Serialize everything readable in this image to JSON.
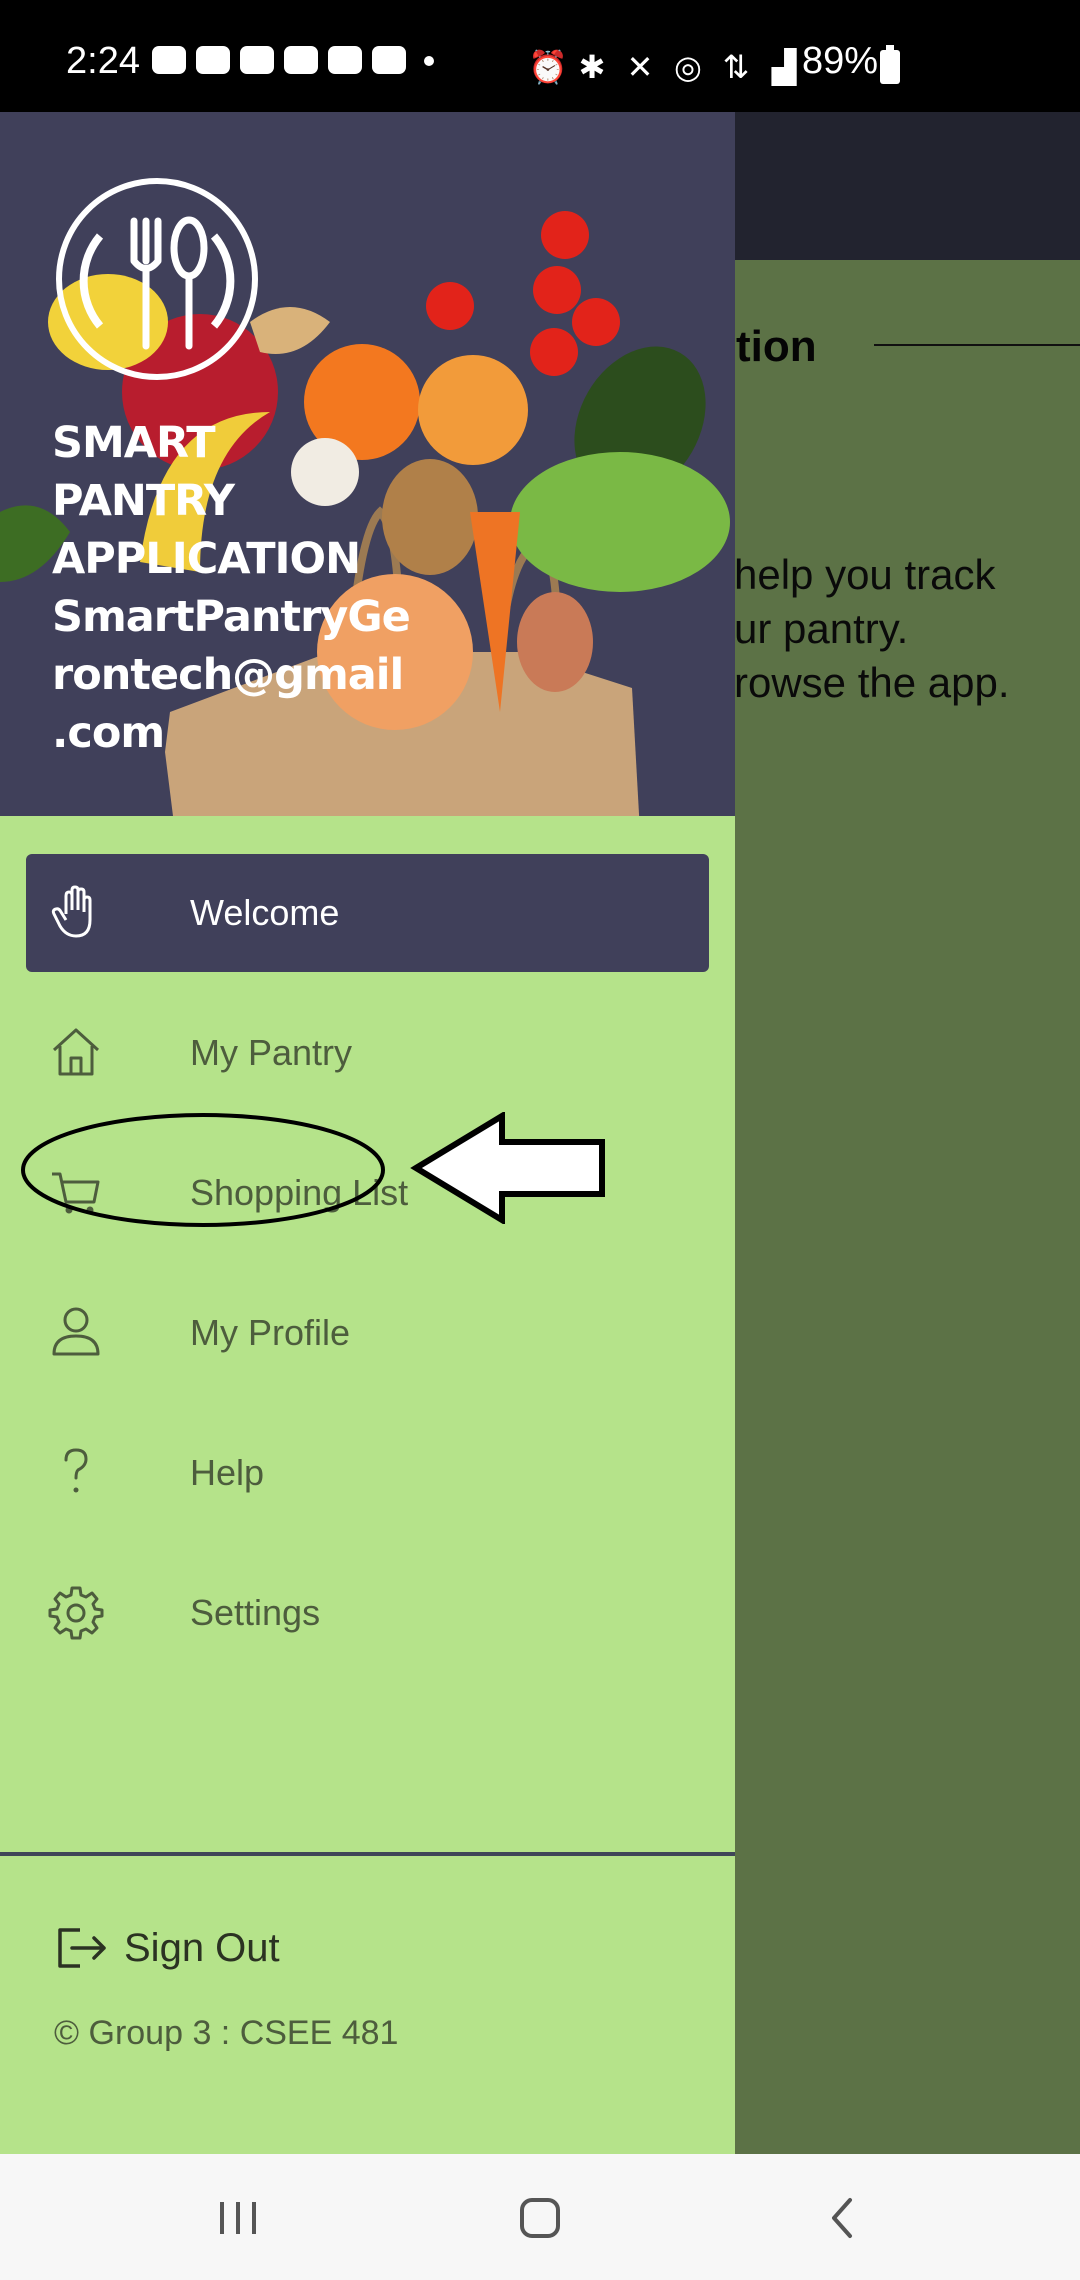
{
  "status_bar": {
    "time": "2:24",
    "notification_icons": [
      "message-icon",
      "discord-icon",
      "discord-icon",
      "chat-icon",
      "youtube-icon",
      "youtube-icon"
    ],
    "system_icons": [
      "alarm-icon",
      "bluetooth-icon",
      "mute-icon",
      "hotspot-icon",
      "4g-icon",
      "signal-icon"
    ],
    "battery_percent": "89%"
  },
  "background_screen": {
    "heading_fragment": "tion",
    "body_lines": [
      "help you track",
      "ur pantry.",
      "rowse the app."
    ]
  },
  "drawer": {
    "header": {
      "title_lines": [
        "SMART",
        "PANTRY",
        "APPLICATION"
      ],
      "email_lines": [
        "SmartPantryGe",
        "rontech@gmail",
        ".com"
      ]
    },
    "menu": [
      {
        "label": "Welcome",
        "icon": "hand-icon",
        "active": true
      },
      {
        "label": "My Pantry",
        "icon": "home-icon",
        "active": false
      },
      {
        "label": "Shopping List",
        "icon": "cart-icon",
        "active": false
      },
      {
        "label": "My Profile",
        "icon": "person-icon",
        "active": false
      },
      {
        "label": "Help",
        "icon": "question-icon",
        "active": false
      },
      {
        "label": "Settings",
        "icon": "gear-icon",
        "active": false
      }
    ],
    "sign_out_label": "Sign Out",
    "footer": "© Group 3 : CSEE 481"
  },
  "colors": {
    "drawer_bg": "#b5e38a",
    "header_bg": "#40405a",
    "active_item_bg": "#40405a",
    "content_bg": "#5c7246",
    "toolbar_bg": "#22232f"
  }
}
